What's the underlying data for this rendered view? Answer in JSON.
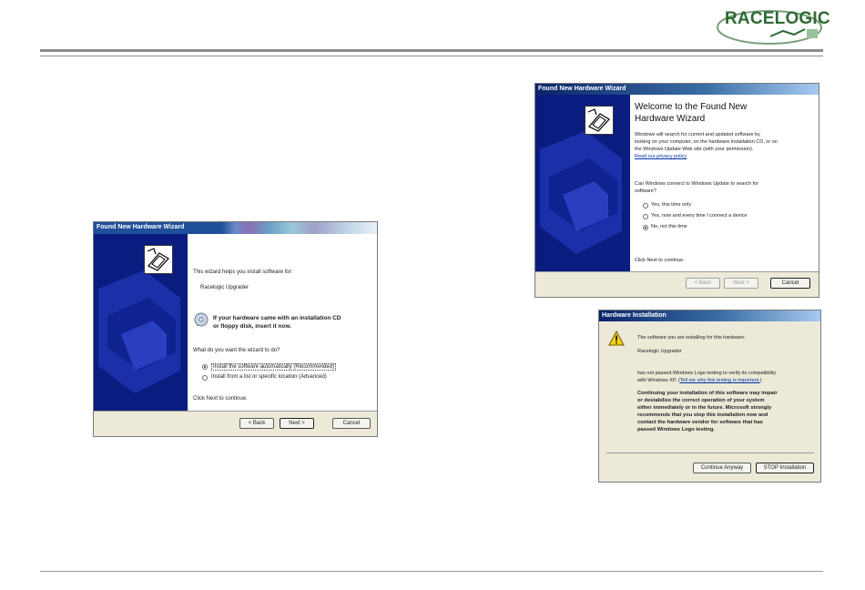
{
  "brand": {
    "logo_text": "RACELOGIC"
  },
  "wizard_left": {
    "title": "Found New Hardware Wizard",
    "intro": "This wizard helps you install software for:",
    "device": "Racelogic Upgrader",
    "cd_prompt_line1": "If your hardware came with an installation CD",
    "cd_prompt_line2": "or floppy disk, insert it now.",
    "question": "What do you want the wizard to do?",
    "options": [
      "Install the software automatically (Recommended)",
      "Install from a list or specific location (Advanced)"
    ],
    "selected_option": 0,
    "continue_text": "Click Next to continue.",
    "buttons": {
      "back": "< Back",
      "next": "Next >",
      "cancel": "Cancel"
    }
  },
  "wizard_right": {
    "title": "Found New Hardware Wizard",
    "heading_line1": "Welcome to the Found New",
    "heading_line2": "Hardware Wizard",
    "body_line1": "Windows will search for current and updated software by",
    "body_line2": "looking on your computer, on the hardware installation CD, or on",
    "body_line3": "the Windows Update Web site (with your permission).",
    "privacy_link": "Read our privacy policy",
    "question_line1": "Can Windows connect to Windows Update to search for",
    "question_line2": "software?",
    "options": [
      "Yes, this time only",
      "Yes, now and every time I connect a device",
      "No, not this time"
    ],
    "selected_option": 2,
    "continue_text": "Click Next to continue.",
    "buttons": {
      "back": "< Back",
      "next": "Next >",
      "cancel": "Cancel"
    }
  },
  "hw_install": {
    "title": "Hardware Installation",
    "line1": "The software you are installing for this hardware:",
    "device": "Racelogic Upgrader",
    "line2": "has not passed Windows Logo testing to verify its compatibility",
    "line3": "with Windows XP. (",
    "link": "Tell me why this testing is important.",
    "line3_end": ")",
    "warning": [
      "Continuing your installation of this software may impair",
      "or destabilize the correct operation of your system",
      "either immediately or in the future. Microsoft strongly",
      "recommends that you stop this installation now and",
      "contact the hardware vendor for software that has",
      "passed Windows Logo testing."
    ],
    "buttons": {
      "continue": "Continue Anyway",
      "stop": "STOP Installation"
    }
  }
}
